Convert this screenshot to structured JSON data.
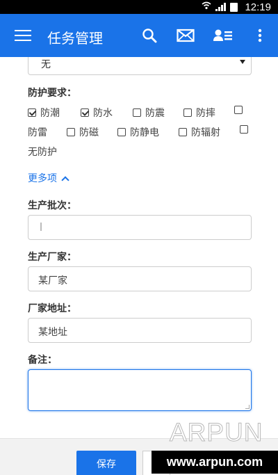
{
  "status_bar": {
    "time": "12:19"
  },
  "app_bar": {
    "title": "任务管理",
    "icons": [
      "menu-icon",
      "search-icon",
      "mail-icon",
      "contacts-icon",
      "more-vertical-icon"
    ]
  },
  "form": {
    "select_value": "无",
    "protection": {
      "label": "防护要求：",
      "options": [
        {
          "label": "防潮",
          "checked": true
        },
        {
          "label": "防水",
          "checked": true
        },
        {
          "label": "防震",
          "checked": false
        },
        {
          "label": "防摔",
          "checked": false
        },
        {
          "label": "防雷",
          "checked": false
        },
        {
          "label": "防磁",
          "checked": false
        },
        {
          "label": "防静电",
          "checked": false
        },
        {
          "label": "防辐射",
          "checked": false
        },
        {
          "label": "无防护",
          "checked": false
        }
      ]
    },
    "more_label": "更多项",
    "batch": {
      "label": "生产批次：",
      "value": ""
    },
    "manufacturer": {
      "label": "生产厂家：",
      "value": "某厂家"
    },
    "address": {
      "label": "厂家地址：",
      "value": "某地址"
    },
    "remarks": {
      "label": "备注：",
      "value": ""
    }
  },
  "actions": {
    "save_label": "保存"
  },
  "watermark": {
    "text": "ARPUN",
    "url": "www.arpun.com"
  }
}
